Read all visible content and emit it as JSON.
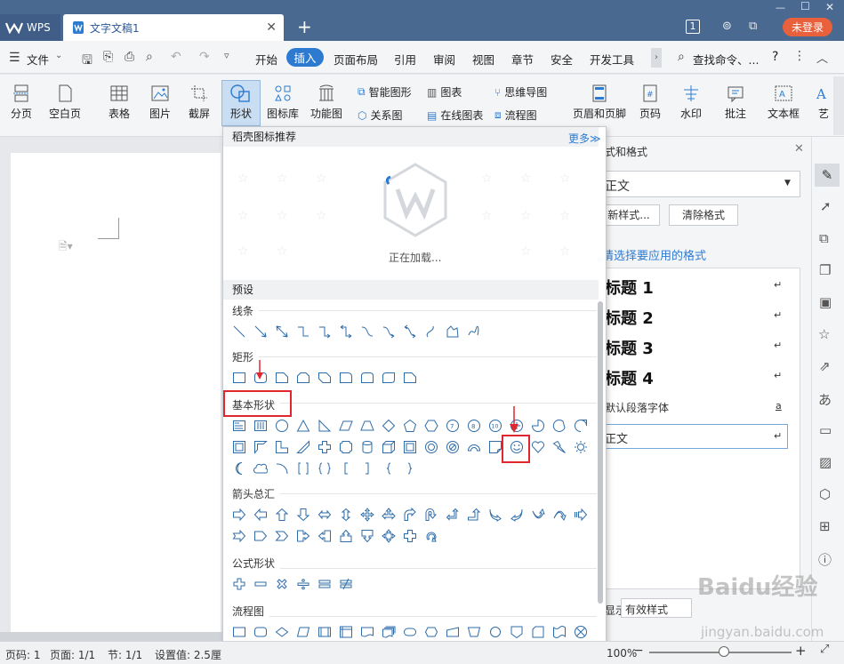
{
  "titlebar": {
    "app_tab": "WPS",
    "doc_tab": "文字文稿1",
    "page_badge": "1",
    "login": "未登录"
  },
  "menubar": {
    "file": "文件",
    "tabs": [
      "开始",
      "插入",
      "页面布局",
      "引用",
      "审阅",
      "视图",
      "章节",
      "安全",
      "开发工具"
    ],
    "active_tab": "插入",
    "search": "查找命令、...",
    "help": "?"
  },
  "ribbon": {
    "page_break": "分页",
    "blank_page": "空白页",
    "table": "表格",
    "picture": "图片",
    "screenshot": "截屏",
    "shape": "形状",
    "icon_lib": "图标库",
    "func_chart": "功能图",
    "smart_art": "智能图形",
    "chart": "图表",
    "mind_map": "思维导图",
    "relation": "关系图",
    "online_chart": "在线图表",
    "flowchart": "流程图",
    "header_footer": "页眉和页脚",
    "page_number": "页码",
    "watermark": "水印",
    "comment": "批注",
    "textbox": "文本框",
    "art": "艺"
  },
  "dropdown": {
    "recommend_title": "稻壳图标推荐",
    "more": "更多≫",
    "loading": "正在加载...",
    "preset": "预设",
    "sections": {
      "lines": "线条",
      "rect": "矩形",
      "basic": "基本形状",
      "arrows": "箭头总汇",
      "formula": "公式形状",
      "flow": "流程图"
    },
    "circle_numbers": [
      "7",
      "8",
      "10"
    ]
  },
  "right_panel": {
    "title": "式和格式",
    "current_style": "正文",
    "new_style": "新样式...",
    "clear_format": "清除格式",
    "select_prompt": "请选择要应用的格式",
    "styles": [
      "标题 1",
      "标题 2",
      "标题 3",
      "标题 4"
    ],
    "default_font": "默认段落字体",
    "body": "正文",
    "show_label": "显示:",
    "show_value": "有效样式"
  },
  "statusbar": {
    "page_code": "页码: 1",
    "pages": "页面: 1/1",
    "section": "节: 1/1",
    "setting": "设置值: 2.5厘",
    "zoom": "100%"
  },
  "watermark": {
    "brand": "Baidu经验",
    "url": "jingyan.baidu.com"
  },
  "colors": {
    "titlebar": "#4a6990",
    "accent": "#2d7bd1",
    "highlight": "#e0262f",
    "login": "#e8603c"
  }
}
